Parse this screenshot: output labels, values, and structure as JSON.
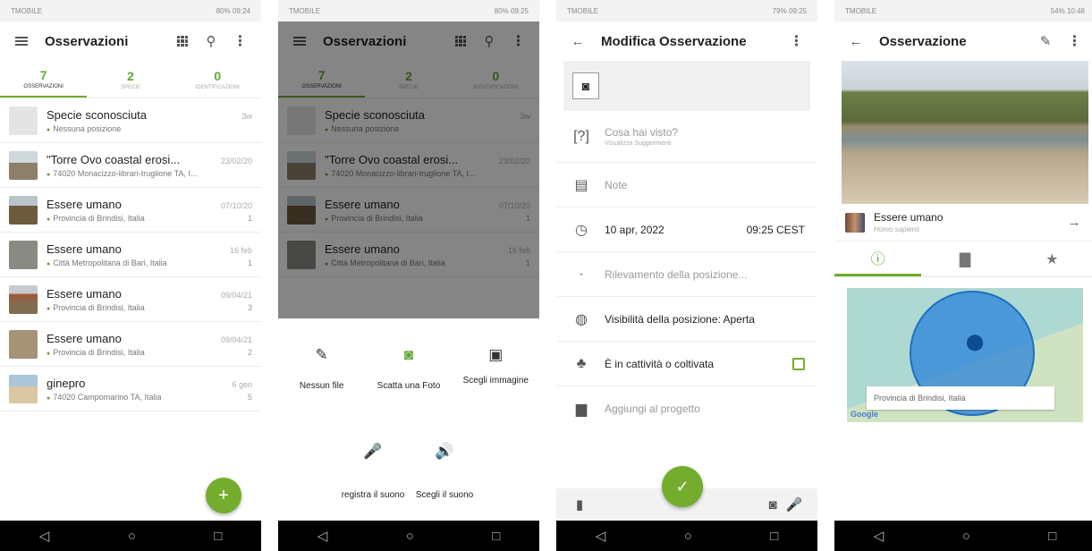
{
  "colors": {
    "accent": "#74ac2e",
    "accent_text": "#5ea931",
    "navbar": "#000000",
    "map_circle": "#247ed9"
  },
  "status": {
    "p1_left": "TMOBILE",
    "p1_right": "80% 09:24",
    "p2_left": "TMOBILE",
    "p2_right": "80% 09:25",
    "p3_left": "TMOBILE",
    "p3_right": "79% 09:25",
    "p4_left": "TMOBILE",
    "p4_right": "54% 10:48"
  },
  "nav": {
    "back": "◁",
    "home": "○",
    "recent": "□"
  },
  "list": {
    "title": "Osservazioni",
    "tabs": [
      {
        "count": "7",
        "label": "OSSERVAZIONI"
      },
      {
        "count": "2",
        "label": "SPECIE"
      },
      {
        "count": "0",
        "label": "IDENTIFICAZIONI"
      }
    ],
    "items": [
      {
        "name": "Specie sconosciuta",
        "place": "Nessuna posizione",
        "date": "3w",
        "count": ""
      },
      {
        "name": "\"Torre Ovo coastal erosi...",
        "place": "74020 Monacizzo-librari-truglione TA, I...",
        "date": "23/02/20",
        "count": ""
      },
      {
        "name": "Essere umano",
        "place": "Provincia di Brindisi, Italia",
        "date": "07/10/20",
        "count": "1"
      },
      {
        "name": "Essere umano",
        "place": "Città Metropolitana di Bari, Italia",
        "date": "16 feb",
        "count": "1"
      },
      {
        "name": "Essere umano",
        "place": "Provincia di Brindisi, Italia",
        "date": "09/04/21",
        "count": "3"
      },
      {
        "name": "Essere umano",
        "place": "Provincia di Brindisi, Italia",
        "date": "09/04/21",
        "count": "2"
      },
      {
        "name": "ginepro",
        "place": "74020 Campomarino TA, Italia",
        "date": "6 gen",
        "count": "5"
      }
    ],
    "fab": "+"
  },
  "sheet": {
    "options_row1": [
      {
        "icon": "✎",
        "label": "Nessun file"
      },
      {
        "icon": "◙",
        "label": "Scatta una Foto"
      },
      {
        "icon": "▣",
        "label": "Scegli immagine"
      }
    ],
    "options_row2": [
      {
        "icon": "🎤",
        "label": "registra il suono"
      },
      {
        "icon": "🔊",
        "label": "Scegli il suono"
      }
    ]
  },
  "edit": {
    "title": "Modifica Osservazione",
    "what_placeholder": "Cosa hai visto?",
    "what_hint": "Visualizza Suggerimenti",
    "notes_placeholder": "Note",
    "date": "10 apr, 2022",
    "time": "09:25 CEST",
    "location": "Rilevamento della posizione...",
    "visibility": "Visibilità della posizione: Aperta",
    "captive": "È in cattività o coltivata",
    "project": "Aggiungi al progetto",
    "save": "✓"
  },
  "detail": {
    "title": "Osservazione",
    "taxon_name": "Essere umano",
    "taxon_sci": "Homo sapiens",
    "map_label": "Provincia di Brindisi, Italia",
    "google": "Google"
  }
}
